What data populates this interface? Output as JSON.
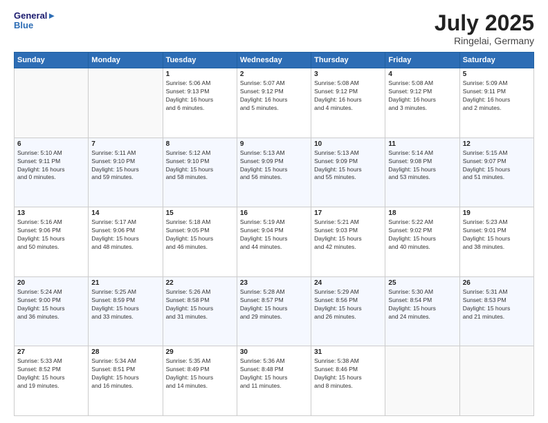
{
  "header": {
    "logo_line1": "General",
    "logo_line2": "Blue",
    "month": "July 2025",
    "location": "Ringelai, Germany"
  },
  "days_of_week": [
    "Sunday",
    "Monday",
    "Tuesday",
    "Wednesday",
    "Thursday",
    "Friday",
    "Saturday"
  ],
  "weeks": [
    [
      {
        "day": "",
        "detail": ""
      },
      {
        "day": "",
        "detail": ""
      },
      {
        "day": "1",
        "detail": "Sunrise: 5:06 AM\nSunset: 9:13 PM\nDaylight: 16 hours\nand 6 minutes."
      },
      {
        "day": "2",
        "detail": "Sunrise: 5:07 AM\nSunset: 9:12 PM\nDaylight: 16 hours\nand 5 minutes."
      },
      {
        "day": "3",
        "detail": "Sunrise: 5:08 AM\nSunset: 9:12 PM\nDaylight: 16 hours\nand 4 minutes."
      },
      {
        "day": "4",
        "detail": "Sunrise: 5:08 AM\nSunset: 9:12 PM\nDaylight: 16 hours\nand 3 minutes."
      },
      {
        "day": "5",
        "detail": "Sunrise: 5:09 AM\nSunset: 9:11 PM\nDaylight: 16 hours\nand 2 minutes."
      }
    ],
    [
      {
        "day": "6",
        "detail": "Sunrise: 5:10 AM\nSunset: 9:11 PM\nDaylight: 16 hours\nand 0 minutes."
      },
      {
        "day": "7",
        "detail": "Sunrise: 5:11 AM\nSunset: 9:10 PM\nDaylight: 15 hours\nand 59 minutes."
      },
      {
        "day": "8",
        "detail": "Sunrise: 5:12 AM\nSunset: 9:10 PM\nDaylight: 15 hours\nand 58 minutes."
      },
      {
        "day": "9",
        "detail": "Sunrise: 5:13 AM\nSunset: 9:09 PM\nDaylight: 15 hours\nand 56 minutes."
      },
      {
        "day": "10",
        "detail": "Sunrise: 5:13 AM\nSunset: 9:09 PM\nDaylight: 15 hours\nand 55 minutes."
      },
      {
        "day": "11",
        "detail": "Sunrise: 5:14 AM\nSunset: 9:08 PM\nDaylight: 15 hours\nand 53 minutes."
      },
      {
        "day": "12",
        "detail": "Sunrise: 5:15 AM\nSunset: 9:07 PM\nDaylight: 15 hours\nand 51 minutes."
      }
    ],
    [
      {
        "day": "13",
        "detail": "Sunrise: 5:16 AM\nSunset: 9:06 PM\nDaylight: 15 hours\nand 50 minutes."
      },
      {
        "day": "14",
        "detail": "Sunrise: 5:17 AM\nSunset: 9:06 PM\nDaylight: 15 hours\nand 48 minutes."
      },
      {
        "day": "15",
        "detail": "Sunrise: 5:18 AM\nSunset: 9:05 PM\nDaylight: 15 hours\nand 46 minutes."
      },
      {
        "day": "16",
        "detail": "Sunrise: 5:19 AM\nSunset: 9:04 PM\nDaylight: 15 hours\nand 44 minutes."
      },
      {
        "day": "17",
        "detail": "Sunrise: 5:21 AM\nSunset: 9:03 PM\nDaylight: 15 hours\nand 42 minutes."
      },
      {
        "day": "18",
        "detail": "Sunrise: 5:22 AM\nSunset: 9:02 PM\nDaylight: 15 hours\nand 40 minutes."
      },
      {
        "day": "19",
        "detail": "Sunrise: 5:23 AM\nSunset: 9:01 PM\nDaylight: 15 hours\nand 38 minutes."
      }
    ],
    [
      {
        "day": "20",
        "detail": "Sunrise: 5:24 AM\nSunset: 9:00 PM\nDaylight: 15 hours\nand 36 minutes."
      },
      {
        "day": "21",
        "detail": "Sunrise: 5:25 AM\nSunset: 8:59 PM\nDaylight: 15 hours\nand 33 minutes."
      },
      {
        "day": "22",
        "detail": "Sunrise: 5:26 AM\nSunset: 8:58 PM\nDaylight: 15 hours\nand 31 minutes."
      },
      {
        "day": "23",
        "detail": "Sunrise: 5:28 AM\nSunset: 8:57 PM\nDaylight: 15 hours\nand 29 minutes."
      },
      {
        "day": "24",
        "detail": "Sunrise: 5:29 AM\nSunset: 8:56 PM\nDaylight: 15 hours\nand 26 minutes."
      },
      {
        "day": "25",
        "detail": "Sunrise: 5:30 AM\nSunset: 8:54 PM\nDaylight: 15 hours\nand 24 minutes."
      },
      {
        "day": "26",
        "detail": "Sunrise: 5:31 AM\nSunset: 8:53 PM\nDaylight: 15 hours\nand 21 minutes."
      }
    ],
    [
      {
        "day": "27",
        "detail": "Sunrise: 5:33 AM\nSunset: 8:52 PM\nDaylight: 15 hours\nand 19 minutes."
      },
      {
        "day": "28",
        "detail": "Sunrise: 5:34 AM\nSunset: 8:51 PM\nDaylight: 15 hours\nand 16 minutes."
      },
      {
        "day": "29",
        "detail": "Sunrise: 5:35 AM\nSunset: 8:49 PM\nDaylight: 15 hours\nand 14 minutes."
      },
      {
        "day": "30",
        "detail": "Sunrise: 5:36 AM\nSunset: 8:48 PM\nDaylight: 15 hours\nand 11 minutes."
      },
      {
        "day": "31",
        "detail": "Sunrise: 5:38 AM\nSunset: 8:46 PM\nDaylight: 15 hours\nand 8 minutes."
      },
      {
        "day": "",
        "detail": ""
      },
      {
        "day": "",
        "detail": ""
      }
    ]
  ]
}
